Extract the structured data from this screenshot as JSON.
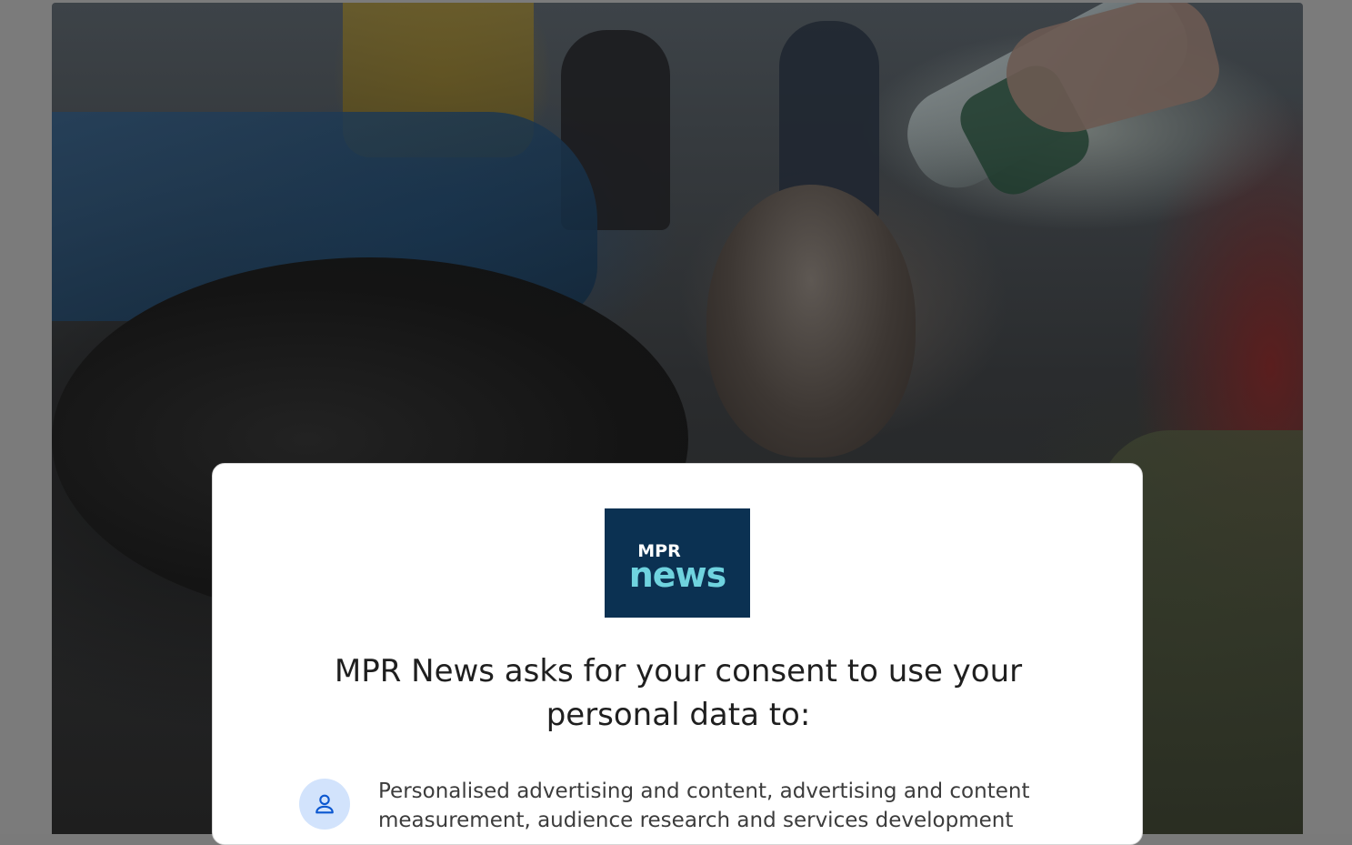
{
  "brand": {
    "logo_top": "MPR",
    "logo_bottom": "news",
    "logo_bg_color": "#0b3152",
    "logo_accent_color": "#6fd3df"
  },
  "hero": {
    "icon": "news-photo"
  },
  "consent": {
    "title": "MPR News asks for your consent to use your personal data to:",
    "purposes": [
      {
        "icon": "person-icon",
        "text": "Personalised advertising and content, advertising and content measurement, audience research and services development"
      }
    ]
  },
  "colors": {
    "overlay": "#7b7b7b",
    "card_bg": "#ffffff",
    "icon_circle": "#d2e3fc",
    "icon_stroke": "#0b57d0"
  }
}
